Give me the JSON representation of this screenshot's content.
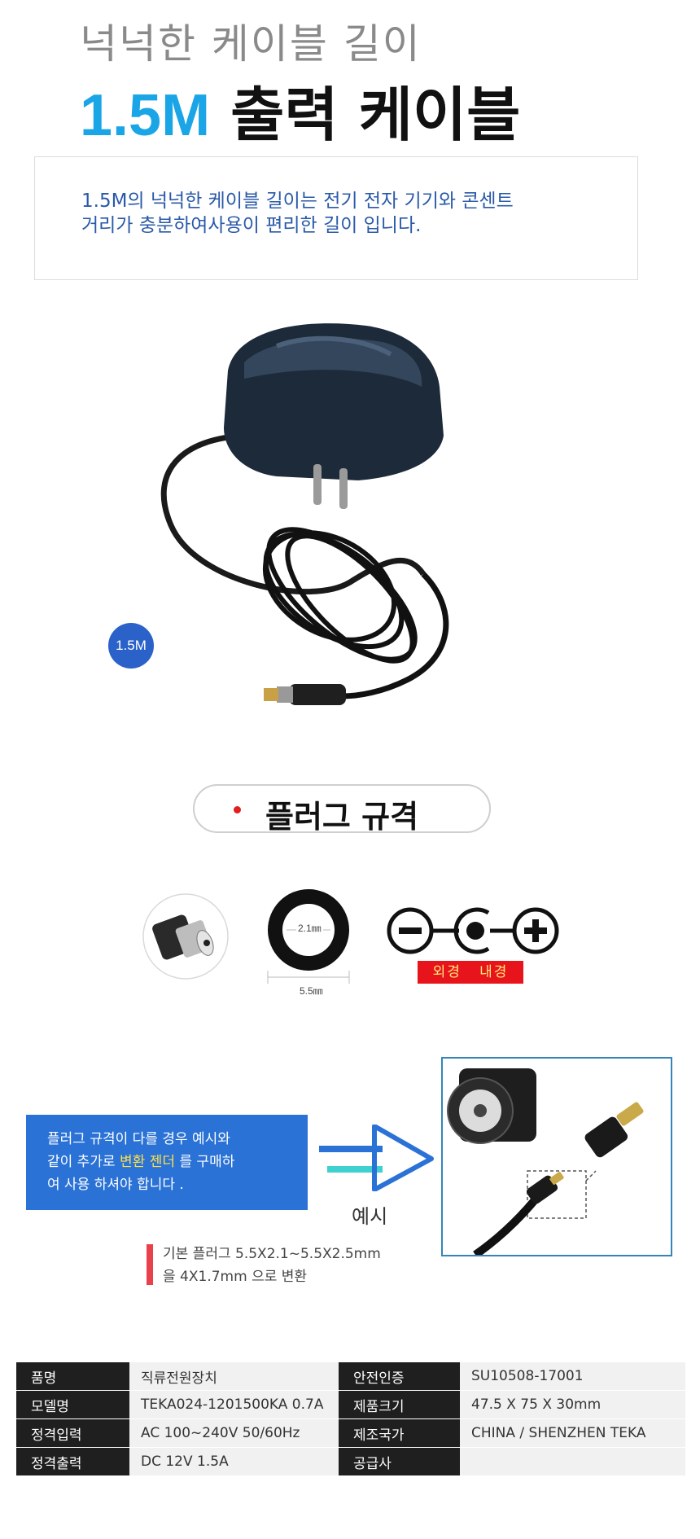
{
  "header": {
    "subtitle": "넉넉한 케이블 길이",
    "title_blue": "1.5M",
    "title_black": "출력 케이블"
  },
  "description": {
    "line1": "1.5M의 넉넉한 케이블 길이는 전기 전자 기기와 콘센트",
    "line2": "거리가 충분하여사용이 편리한 길이 입니다."
  },
  "product": {
    "cable_length_badge": "1.5M"
  },
  "plug_spec": {
    "heading": "플러그 규격",
    "inner_diameter": "2.1㎜",
    "outer_diameter": "5.5㎜",
    "polarity_label": "외경   내경",
    "colors": {
      "accent_red": "#e8141c",
      "label_yellow": "#ffe87a"
    }
  },
  "notice": {
    "line1": "플러그 규격이 다를 경우 예시와",
    "line2_prefix": "같이 추가로 ",
    "line2_highlight": "변환 젠더",
    "line2_suffix": " 를 구매하",
    "line3": "여 사용 하셔야 합니다 .",
    "example_label": "예시",
    "note_line1": "기본 플러그 5.5X2.1~5.5X2.5mm",
    "note_line2": "을 4X1.7mm 으로 변환",
    "colors": {
      "notice_bg": "#2a72d6",
      "highlight": "#ffe04a"
    }
  },
  "specs": {
    "rows": [
      {
        "label": "품명",
        "value": "직류전원장치",
        "label2": "안전인증",
        "value2": "SU10508-17001"
      },
      {
        "label": "모델명",
        "value": "TEKA024-1201500KA 0.7A",
        "label2": "제품크기",
        "value2": "47.5 X 75 X 30mm"
      },
      {
        "label": "정격입력",
        "value": "AC 100~240V 50/60Hz",
        "label2": "제조국가",
        "value2": "CHINA / SHENZHEN TEKA"
      },
      {
        "label": "정격출력",
        "value": "DC 12V 1.5A",
        "label2": "공급사",
        "value2": ""
      }
    ]
  }
}
